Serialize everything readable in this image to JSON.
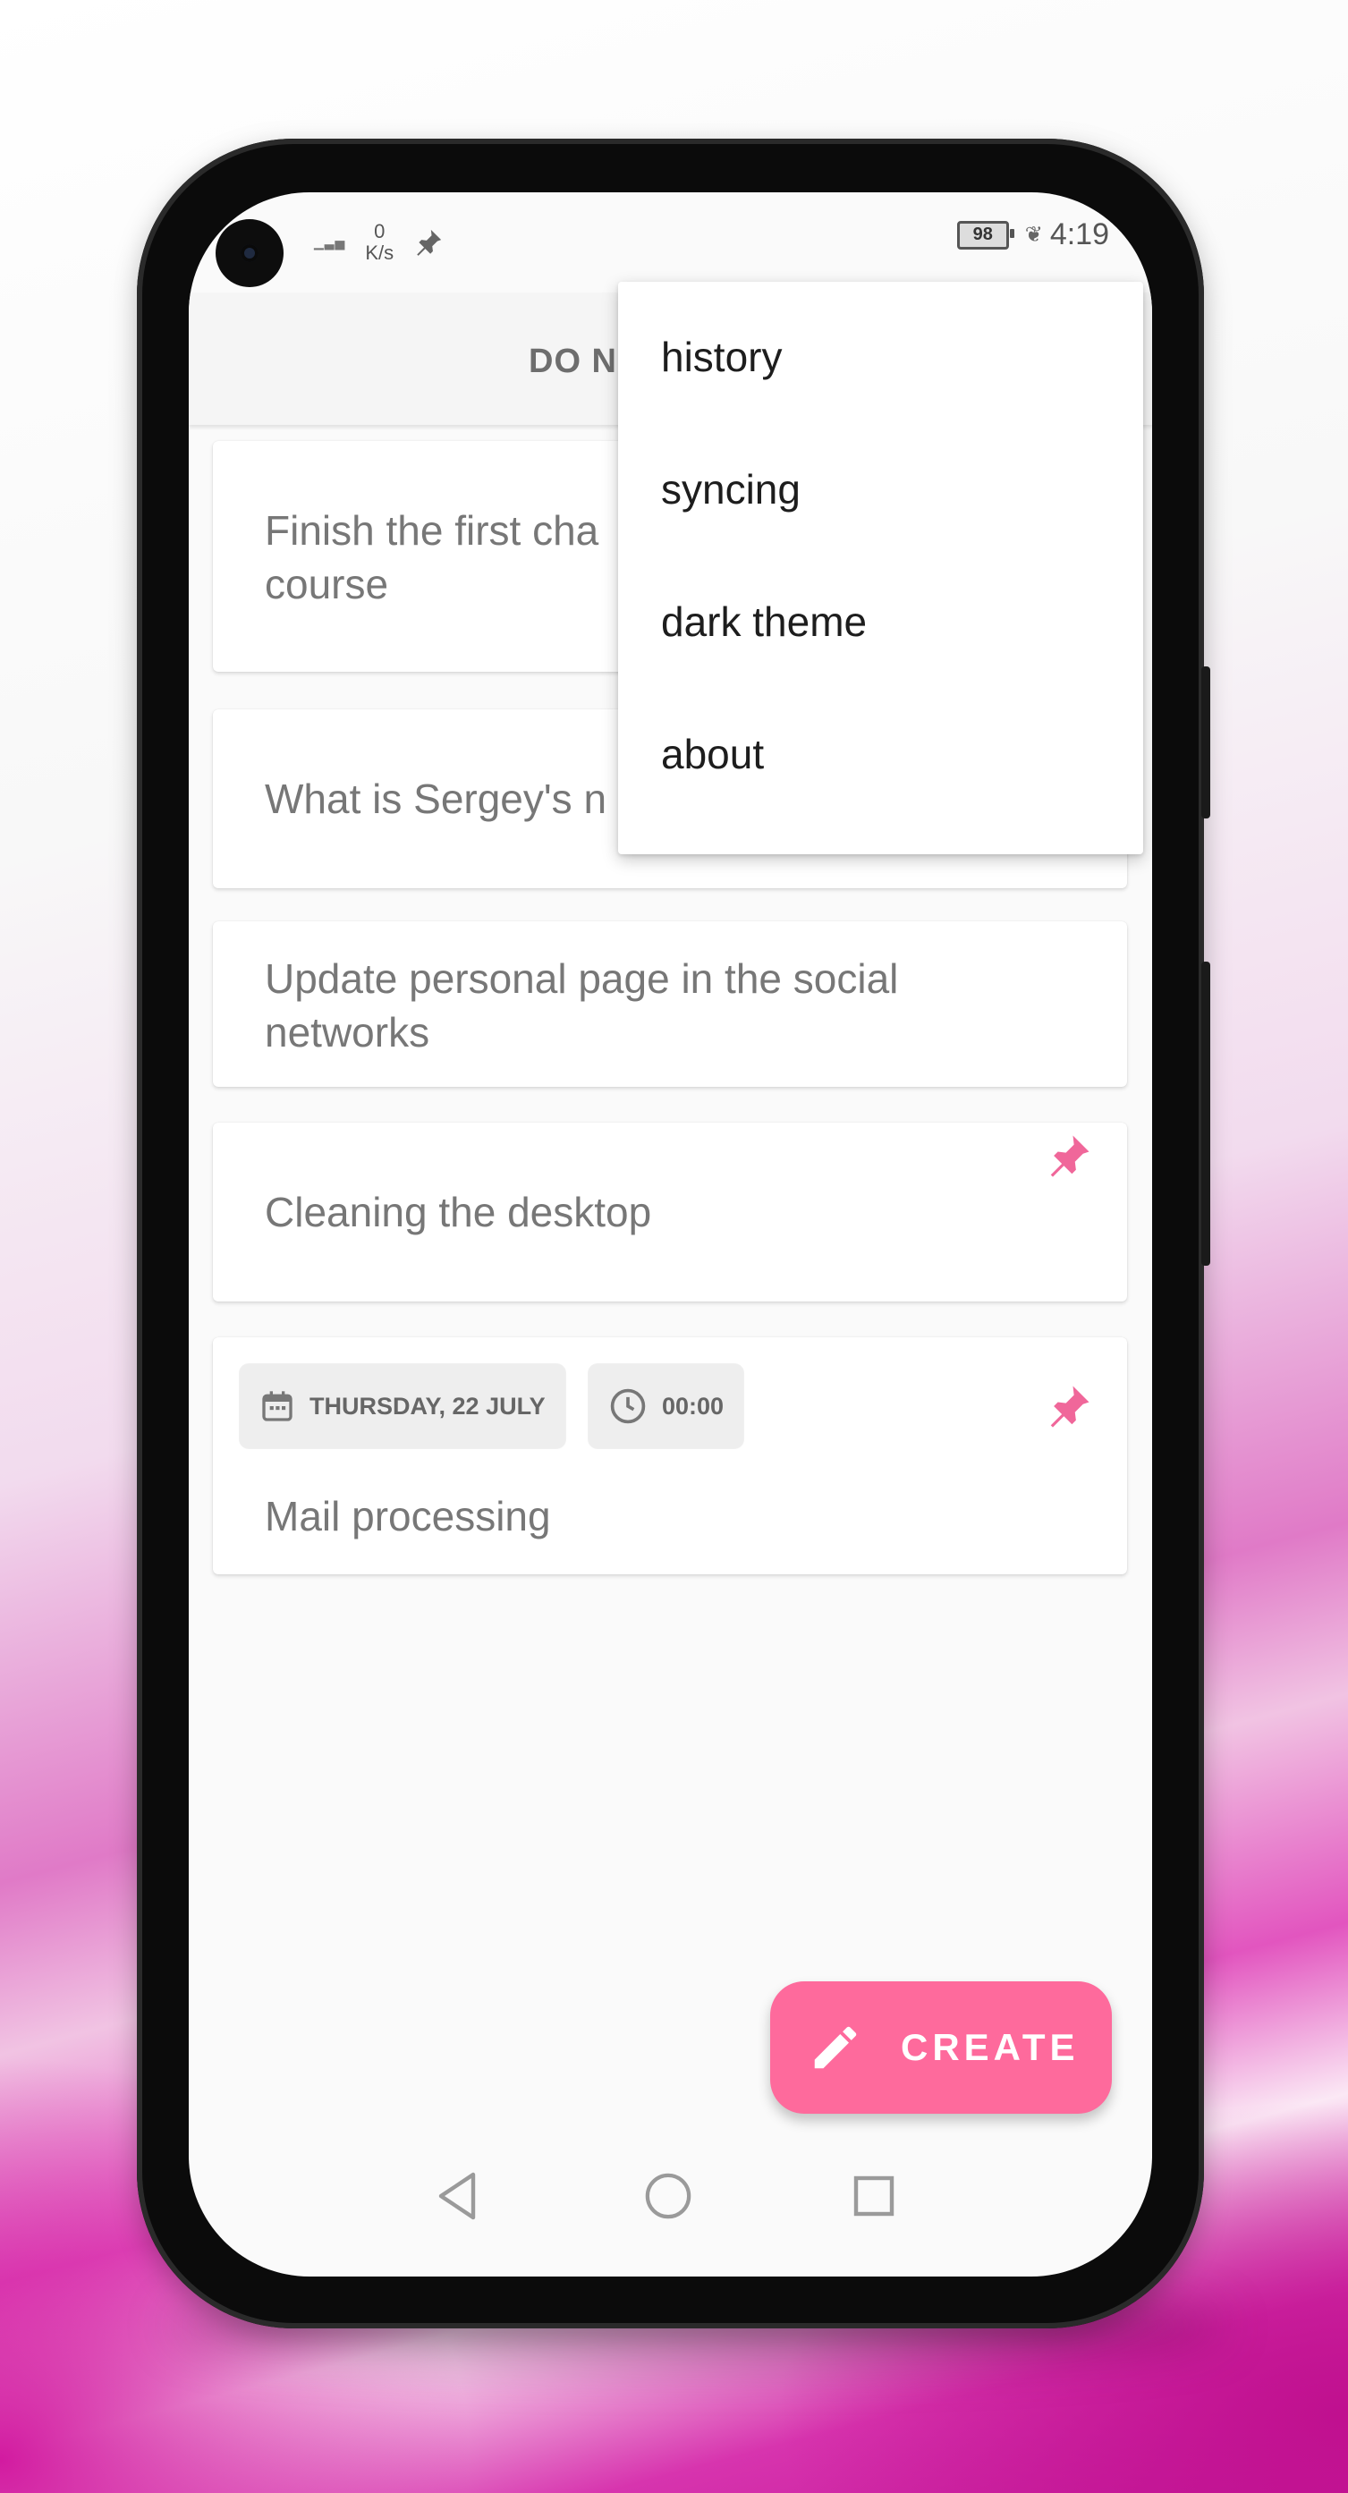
{
  "status_bar": {
    "network_speed_value": "0",
    "network_speed_unit": "K/s",
    "battery": "98",
    "time": "4:19"
  },
  "app_bar": {
    "title": "DO N"
  },
  "overflow_menu": {
    "items": [
      "history",
      "syncing",
      "dark theme",
      "about"
    ]
  },
  "tasks": [
    {
      "text": "Finish the first cha course",
      "line1": "Finish the first cha",
      "line2": "course",
      "pinned": false
    },
    {
      "text": "What is Sergey's n",
      "pinned": false
    },
    {
      "text": "Update personal page in the social networks",
      "line1": "Update personal page in the social",
      "line2": "networks",
      "pinned": false
    },
    {
      "text": "Cleaning the desktop",
      "pinned": true
    },
    {
      "text": "Mail processing",
      "pinned": true,
      "date": "THURSDAY, 22 JULY",
      "time": "00:00"
    }
  ],
  "fab": {
    "label": "CREATE"
  },
  "colors": {
    "accent": "#fe6a9c",
    "pin": "#f0679a",
    "background": "#fafafa"
  },
  "icons": {
    "fab": "pencil-icon",
    "pin": "pin-icon",
    "date_chip": "calendar-icon",
    "time_chip": "clock-icon",
    "nav": [
      "back-triangle-icon",
      "home-circle-icon",
      "recents-square-icon"
    ]
  }
}
